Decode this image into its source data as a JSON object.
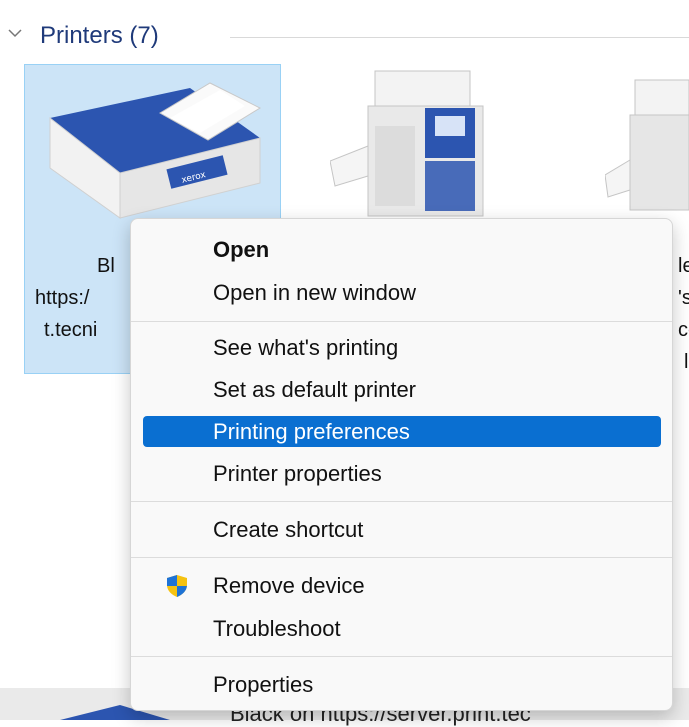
{
  "group": {
    "title": "Printers (7)"
  },
  "tiles": [
    {
      "lines": [
        "Bl",
        "https:/",
        "t.tecni"
      ]
    },
    {
      "lines": [
        "le",
        "'s",
        "co",
        "l"
      ]
    }
  ],
  "printer_brand": "xerox",
  "context_menu": {
    "items": [
      {
        "label": "Open"
      },
      {
        "label": "Open in new window"
      },
      {
        "label": "See what's printing"
      },
      {
        "label": "Set as default printer"
      },
      {
        "label": "Printing preferences"
      },
      {
        "label": "Printer properties"
      },
      {
        "label": "Create shortcut"
      },
      {
        "label": "Remove device"
      },
      {
        "label": "Troubleshoot"
      },
      {
        "label": "Properties"
      }
    ]
  },
  "bottom": {
    "text": "Black on https://server.print.tec"
  },
  "colors": {
    "accent": "#0a6fd1",
    "selection": "#cce4f7",
    "group_title": "#1f3a7a"
  },
  "icons": [
    "chevron-down-icon",
    "uac-shield-icon",
    "printer-icon"
  ]
}
